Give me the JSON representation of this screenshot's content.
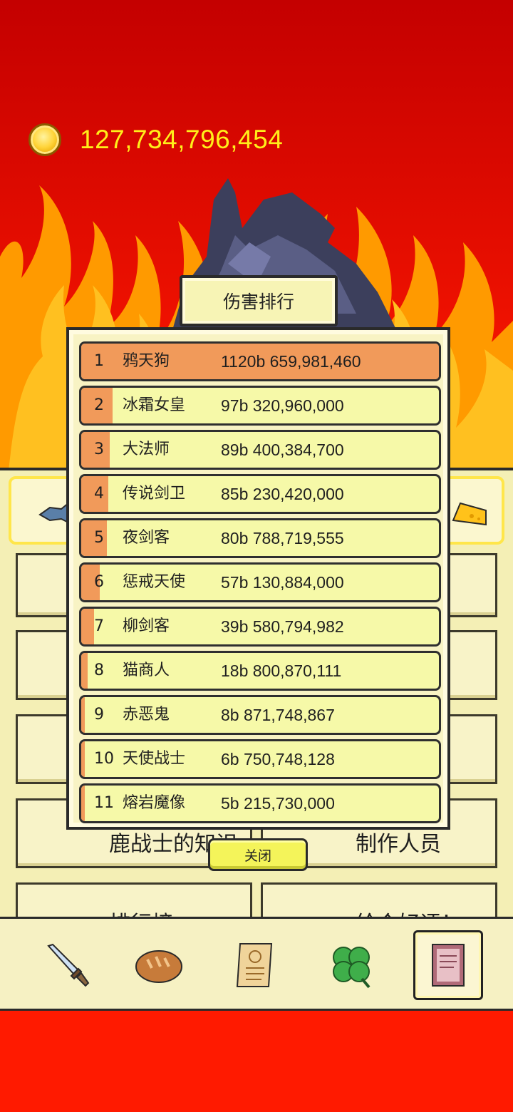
{
  "currency": {
    "amount": "127,734,796,454"
  },
  "popup": {
    "title": "伤害排行",
    "close_label": "关闭",
    "rankings": [
      {
        "rank": "1",
        "name": "鸦天狗",
        "damage": "1120b 659,981,460",
        "share": 1.0
      },
      {
        "rank": "2",
        "name": "冰霜女皇",
        "damage": "97b 320,960,000",
        "share": 0.087
      },
      {
        "rank": "3",
        "name": "大法师",
        "damage": "89b 400,384,700",
        "share": 0.08
      },
      {
        "rank": "4",
        "name": "传说剑卫",
        "damage": "85b 230,420,000",
        "share": 0.076
      },
      {
        "rank": "5",
        "name": "夜剑客",
        "damage": "80b 788,719,555",
        "share": 0.072
      },
      {
        "rank": "6",
        "name": "惩戒天使",
        "damage": "57b 130,884,000",
        "share": 0.051
      },
      {
        "rank": "7",
        "name": "柳剑客",
        "damage": "39b 580,794,982",
        "share": 0.035
      },
      {
        "rank": "8",
        "name": "猫商人",
        "damage": "18b 800,870,111",
        "share": 0.017
      },
      {
        "rank": "9",
        "name": "赤恶鬼",
        "damage": "8b 871,748,867",
        "share": 0.008
      },
      {
        "rank": "10",
        "name": "天使战士",
        "damage": "6b 750,748,128",
        "share": 0.006
      },
      {
        "rank": "11",
        "name": "熔岩魔像",
        "damage": "5b 215,730,000",
        "share": 0.005
      }
    ]
  },
  "menu": {
    "items": [
      {
        "label": "鹿战士的知识"
      },
      {
        "label": "制作人员"
      },
      {
        "label": "排行榜"
      },
      {
        "label": "给个好评！"
      }
    ]
  },
  "tabbar": {
    "tabs": [
      {
        "icon": "sword-icon"
      },
      {
        "icon": "bread-icon"
      },
      {
        "icon": "scroll-icon"
      },
      {
        "icon": "clover-icon"
      },
      {
        "icon": "book-icon"
      }
    ],
    "active_index": 4
  },
  "colors": {
    "bar_fill": "#f19a5a",
    "row_bg": "#f6f9a8",
    "coin_text": "#ffef1a"
  }
}
